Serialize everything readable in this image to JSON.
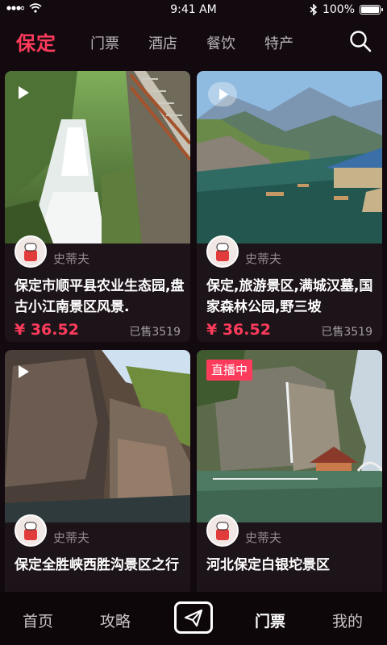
{
  "status": {
    "time": "9:41 AM",
    "battery": "100%",
    "battery_level": 1.0
  },
  "nav": {
    "city": "保定",
    "tabs": [
      "门票",
      "酒店",
      "餐饮",
      "特产"
    ],
    "search_icon": "search-icon"
  },
  "cards": [
    {
      "badge": "play",
      "author": "史蒂夫",
      "title": "保定市顺平县农业生态园,盘古小江南景区风景.",
      "price": "¥ 36.52",
      "sold": "已售3519"
    },
    {
      "badge": "play",
      "author": "史蒂夫",
      "title": "保定,旅游景区,满城汉墓,国家森林公园,野三坡",
      "price": "¥ 36.52",
      "sold": "已售3519"
    },
    {
      "badge": "play",
      "author": "史蒂夫",
      "title": "保定全胜峡西胜沟景区之行"
    },
    {
      "badge": "live",
      "live_label": "直播中",
      "author": "史蒂夫",
      "title": "河北保定白银坨景区"
    }
  ],
  "bottom_nav": {
    "items": [
      "首页",
      "攻略",
      "门票",
      "我的"
    ],
    "active": "门票",
    "center_icon": "send-icon"
  },
  "colors": {
    "accent": "#ff3b5c",
    "background": "#120a0e"
  }
}
